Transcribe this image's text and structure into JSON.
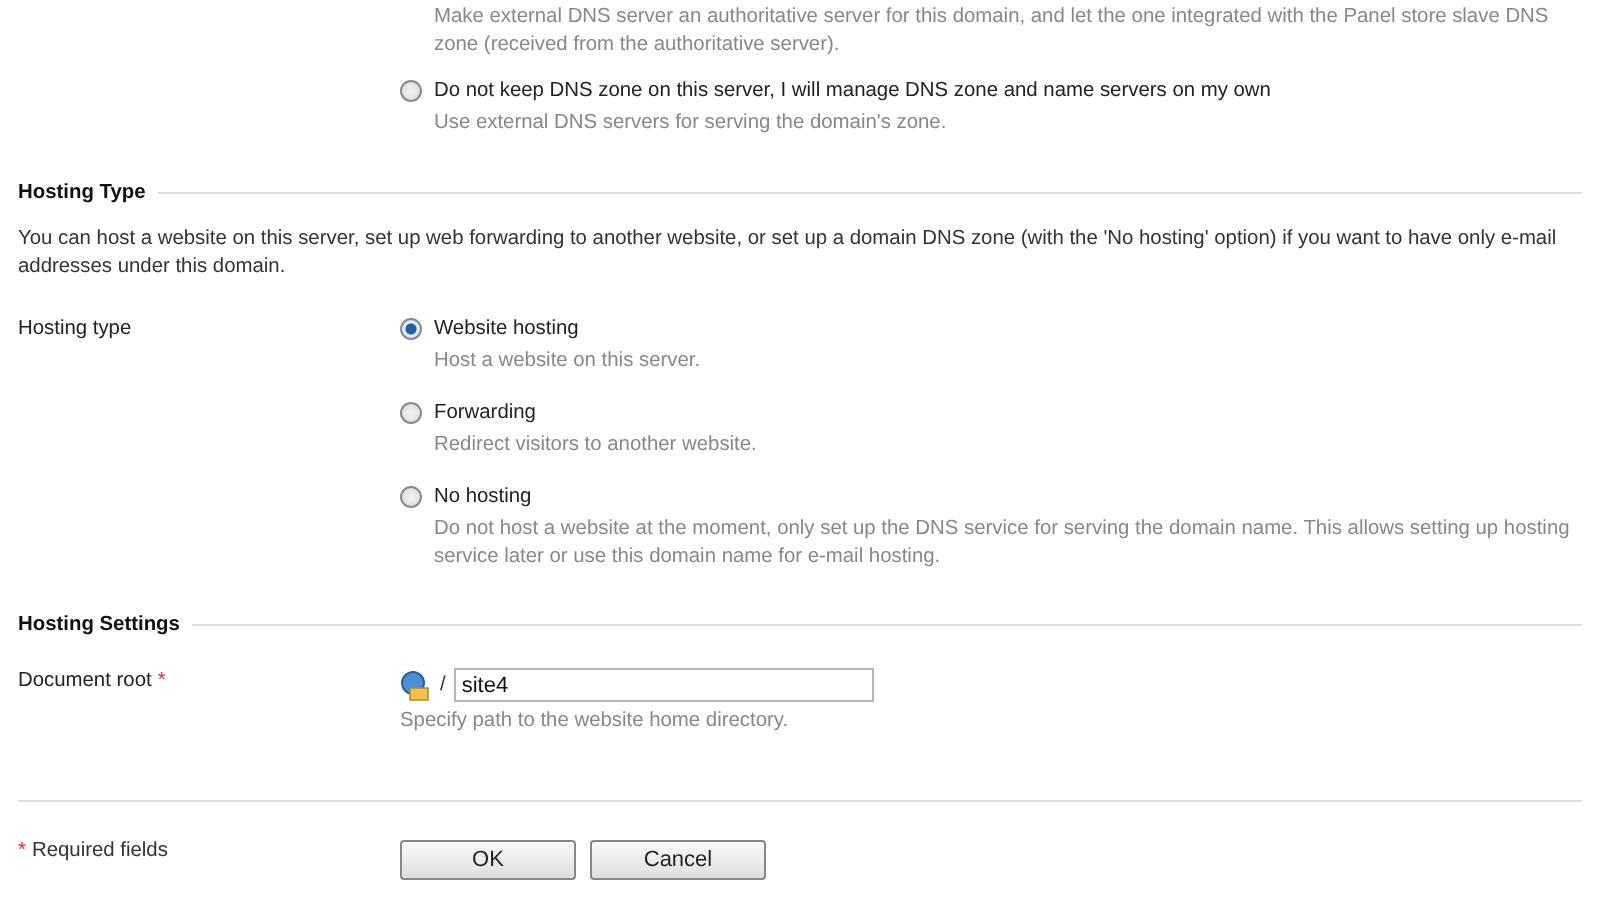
{
  "dns_partial_description": "Make external DNS server an authoritative server for this domain, and let the one integrated with the Panel store slave DNS zone (received from the authoritative server).",
  "dns_options": [
    {
      "label": "Do not keep DNS zone on this server, I will manage DNS zone and name servers on my own",
      "description": "Use external DNS servers for serving the domain's zone.",
      "selected": false
    }
  ],
  "hosting_type": {
    "title": "Hosting Type",
    "intro": "You can host a website on this server, set up web forwarding to another website, or set up a domain DNS zone (with the 'No hosting' option) if you want to have only e-mail addresses under this domain.",
    "field_label": "Hosting type",
    "options": [
      {
        "label": "Website hosting",
        "description": "Host a website on this server.",
        "selected": true
      },
      {
        "label": "Forwarding",
        "description": "Redirect visitors to another website.",
        "selected": false
      },
      {
        "label": "No hosting",
        "description": "Do not host a website at the moment, only set up the DNS service for serving the domain name. This allows setting up hosting service later or use this domain name for e-mail hosting.",
        "selected": false
      }
    ]
  },
  "hosting_settings": {
    "title": "Hosting Settings",
    "field_label": "Document root",
    "required_mark": "*",
    "separator": "/",
    "value": "site4",
    "hint": "Specify path to the website home directory."
  },
  "footer": {
    "required_mark": "*",
    "required_note": "Required fields",
    "buttons": [
      "OK",
      "Cancel"
    ]
  }
}
